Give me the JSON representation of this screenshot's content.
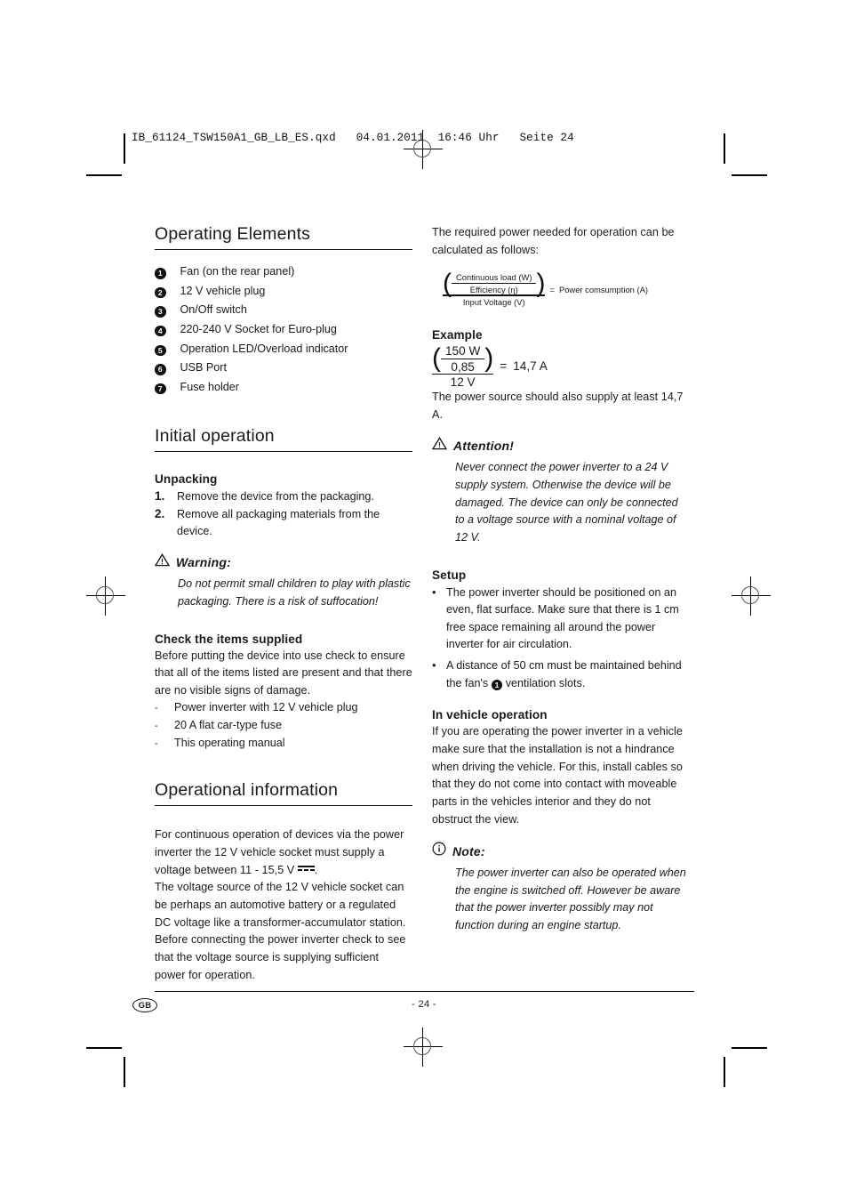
{
  "file_header": "IB_61124_TSW150A1_GB_LB_ES.qxd   04.01.2011  16:46 Uhr   Seite 24",
  "left_column": {
    "operating_elements": {
      "heading": "Operating Elements",
      "items": [
        {
          "num": "1",
          "label": "Fan (on the rear panel)"
        },
        {
          "num": "2",
          "label": "12 V vehicle plug"
        },
        {
          "num": "3",
          "label": "On/Off switch"
        },
        {
          "num": "4",
          "label": "220-240 V Socket for Euro-plug"
        },
        {
          "num": "5",
          "label": "Operation LED/Overload indicator"
        },
        {
          "num": "6",
          "label": "USB Port"
        },
        {
          "num": "7",
          "label": "Fuse holder"
        }
      ]
    },
    "initial_operation": {
      "heading": "Initial operation",
      "unpacking": {
        "heading": "Unpacking",
        "steps": [
          {
            "num": "1.",
            "text": "Remove the device from the packaging."
          },
          {
            "num": "2.",
            "text": "Remove all packaging materials from the device."
          }
        ]
      },
      "warning": {
        "icon": "warning-triangle-icon",
        "title": "Warning:",
        "body": "Do not permit small children to play with plastic packaging. There is a risk of suffocation!"
      },
      "check_items": {
        "heading": "Check the items supplied",
        "intro": "Before putting the device into use check to ensure that all of the items listed are present and that there are no visible signs of damage.",
        "items": [
          "Power inverter with 12 V vehicle plug",
          "20 A flat car-type fuse",
          "This operating manual"
        ]
      }
    },
    "operational_information": {
      "heading": "Operational information",
      "para1_before_dc": "For continuous operation of devices via the power inverter the 12 V vehicle socket must supply a voltage between 11 - 15,5 V ",
      "dc_symbol_name": "dc-voltage-symbol",
      "para1_after_dc": ".",
      "para2": "The voltage source of the 12 V vehicle socket can be perhaps an automotive battery or a regulated DC voltage like a transformer-accumulator station. Before connecting the power inverter check to see that the voltage source is supplying sufficient power for operation."
    }
  },
  "right_column": {
    "intro": "The required power needed for operation can be calculated as follows:",
    "generic_formula": {
      "numerator_top": "Continuous load (W)",
      "numerator_bottom": "Efficiency (η)",
      "denominator": "Input Voltage (V)",
      "equals": "=",
      "result": "Power comsumption (A)"
    },
    "example": {
      "heading": "Example",
      "numerator_top": "150 W",
      "numerator_bottom": "0,85",
      "denominator": "12 V",
      "equals": "=",
      "result": "14,7 A",
      "note": "The power source should also supply at least 14,7 A."
    },
    "attention": {
      "icon": "warning-triangle-icon",
      "title": "Attention!",
      "body": "Never connect the power inverter to a 24 V supply system. Otherwise the device will be damaged. The device can only be connected to a voltage source with a nominal voltage of 12 V."
    },
    "setup": {
      "heading": "Setup",
      "bullet1": "The power inverter should be positioned on an even, flat surface. Make sure that there is 1 cm free space remaining all around the power inverter for air circulation.",
      "bullet2_before": "A distance of 50 cm must be maintained behind the fan's ",
      "bullet2_badge": "1",
      "bullet2_after": " ventilation slots."
    },
    "in_vehicle_operation": {
      "heading": "In vehicle operation",
      "body": "If you are operating the power inverter in a vehicle make sure that the installation is not a hindrance when driving the vehicle. For this, install cables so that they do not come into contact with moveable parts in the vehicles interior and they do not obstruct the view."
    },
    "note": {
      "icon": "info-circle-icon",
      "title": "Note:",
      "body": "The power inverter can also be operated when the engine is switched off. However be aware that the power inverter possibly may not function during an engine startup."
    }
  },
  "footer": {
    "language_badge": "GB",
    "page_number": "- 24 -"
  }
}
